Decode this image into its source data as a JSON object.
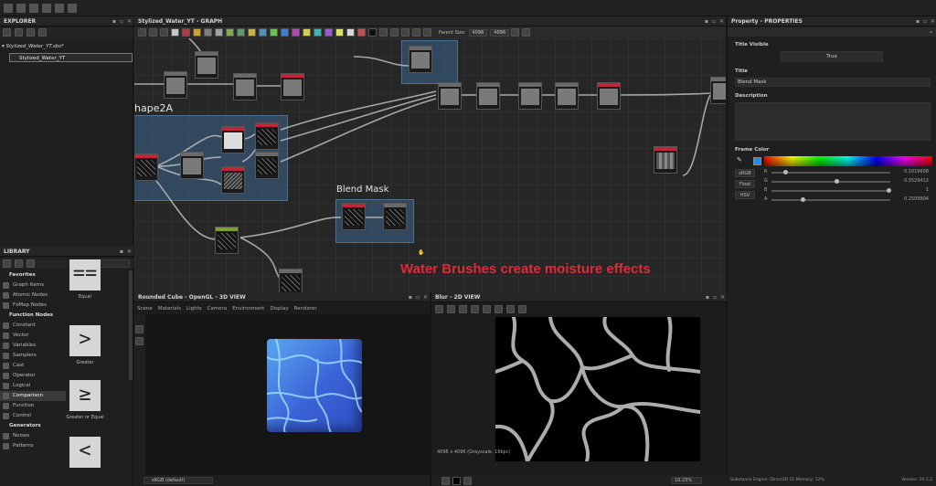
{
  "explorer": {
    "title": "EXPLORER",
    "package_name": "Stylized_Water_YT.sbs*",
    "graph_name": "Stylized_Water_YT"
  },
  "library": {
    "title": "LIBRARY",
    "search_placeholder": "Search",
    "items": [
      {
        "label": "Favorites",
        "type": "bold"
      },
      {
        "label": "Graph Items",
        "type": "normal"
      },
      {
        "label": "Atomic Nodes",
        "type": "normal"
      },
      {
        "label": "FxMap Nodes",
        "type": "normal"
      },
      {
        "label": "Function Nodes",
        "type": "bold"
      },
      {
        "label": "Constant",
        "type": "normal"
      },
      {
        "label": "Vector",
        "type": "normal"
      },
      {
        "label": "Variables",
        "type": "normal"
      },
      {
        "label": "Samplers",
        "type": "normal"
      },
      {
        "label": "Cast",
        "type": "normal"
      },
      {
        "label": "Operator",
        "type": "normal"
      },
      {
        "label": "Logical",
        "type": "normal"
      },
      {
        "label": "Comparison",
        "type": "selected"
      },
      {
        "label": "Function",
        "type": "normal"
      },
      {
        "label": "Control",
        "type": "normal"
      },
      {
        "label": "Generators",
        "type": "bold"
      },
      {
        "label": "Noises",
        "type": "normal"
      },
      {
        "label": "Patterns",
        "type": "normal"
      }
    ],
    "tiles": [
      {
        "glyph": "==",
        "label": "Equal"
      },
      {
        "glyph": ">",
        "label": "Greater"
      },
      {
        "glyph": "≥",
        "label": "Greater or Equal"
      },
      {
        "glyph": "<",
        "label": ""
      }
    ]
  },
  "graph": {
    "title": "Stylized_Water_YT - GRAPH",
    "parent_size_label": "Parent Size:",
    "parent_size_value": "4096",
    "size_value": "4096",
    "frame_left_label": "hape2A",
    "frame_blend_label": "Blend Mask",
    "overlay_text": "Water Brushes create moisture effects",
    "overlay_color": "#e02a3a"
  },
  "properties": {
    "title": "Property - PROPERTIES",
    "title_visible_label": "Title Visible",
    "title_visible_value": "True",
    "title_label": "Title",
    "title_value": "Blend Mask",
    "description_label": "Description",
    "frame_color_label": "Frame Color",
    "modes": [
      "sRGB",
      "Float",
      "HSV"
    ],
    "channels": [
      {
        "name": "R",
        "value": "0.1019608",
        "fraction": 0.1
      },
      {
        "name": "G",
        "value": "0.5529412",
        "fraction": 0.55
      },
      {
        "name": "B",
        "value": "1",
        "fraction": 1.0
      },
      {
        "name": "A",
        "value": "0.2509804",
        "fraction": 0.25
      }
    ]
  },
  "view3d": {
    "title": "Rounded Cube - OpenGL - 3D VIEW",
    "menu": [
      "Scene",
      "Materials",
      "Lights",
      "Camera",
      "Environment",
      "Display",
      "Renderer"
    ],
    "colorspace": "sRGB (default)"
  },
  "view2d": {
    "title": "Blur - 2D VIEW",
    "info": "4096 x 4096 (Grayscale, 16bpc)",
    "zoom": "10.23%"
  },
  "status": {
    "engine": "Substance Engine: Direct3D 11  Memory: 12%",
    "version": "Version: 10.2.2"
  }
}
